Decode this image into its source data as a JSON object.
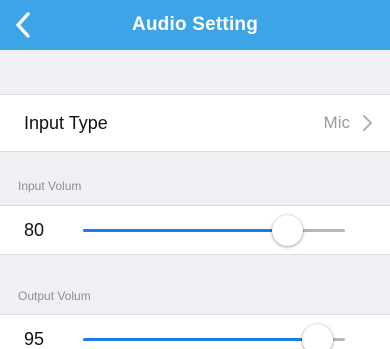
{
  "colors": {
    "nav_background": "#3ea4e8",
    "accent": "#1c7ce6",
    "page_background": "#efeff4"
  },
  "navbar": {
    "title": "Audio Setting",
    "back_icon": "chevron-left-icon"
  },
  "input_type": {
    "label": "Input Type",
    "value": "Mic",
    "chevron_icon": "chevron-right-icon"
  },
  "input_volume": {
    "header": "Input Volum",
    "value": "80",
    "level_fraction": 0.78
  },
  "output_volume": {
    "header": "Output Volum",
    "value": "95",
    "level_fraction": 0.895
  }
}
